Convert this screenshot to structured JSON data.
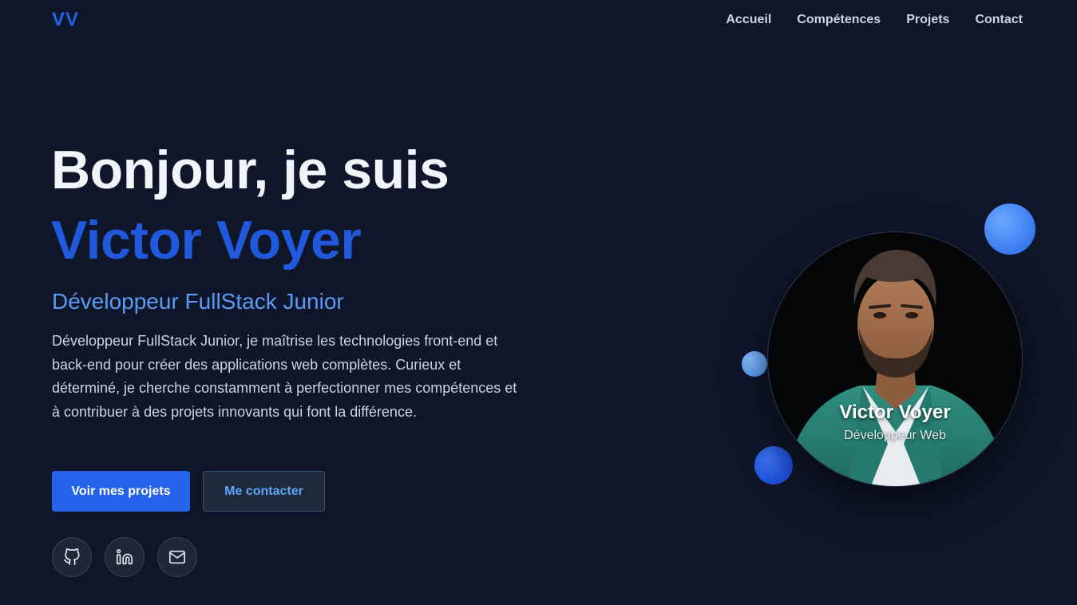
{
  "header": {
    "logo": "VV",
    "nav": [
      "Accueil",
      "Compétences",
      "Projets",
      "Contact"
    ]
  },
  "hero": {
    "greeting": "Bonjour, je suis",
    "name": "Victor Voyer",
    "title": "Développeur FullStack Junior",
    "description": "Développeur FullStack Junior, je maîtrise les technologies front-end et back-end pour créer des applications web complètes. Curieux et déterminé, je cherche constamment à perfectionner mes compétences et à contribuer à des projets innovants qui font la différence.",
    "primary_button": "Voir mes projets",
    "secondary_button": "Me contacter",
    "social_icons": [
      "github-icon",
      "linkedin-icon",
      "mail-icon"
    ]
  },
  "profile_card": {
    "name": "Victor Voyer",
    "role": "Développeur Web"
  },
  "colors": {
    "background": "#0f1629",
    "accent": "#2563eb",
    "accent_light": "#5b9bf5"
  }
}
